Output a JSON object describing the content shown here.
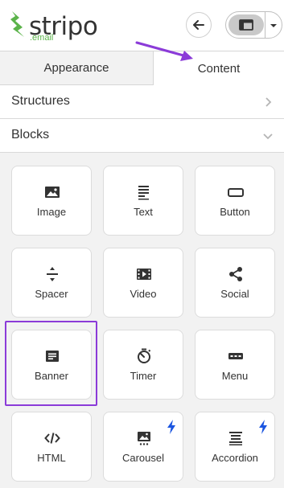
{
  "brand": {
    "name": "stripo",
    "sub": ".email",
    "accent": "#5bb34a"
  },
  "header": {
    "back_icon": "arrow-left-icon",
    "layout_icon": "layout-icon",
    "dropdown_icon": "chevron-down-icon"
  },
  "tabs": [
    {
      "label": "Appearance",
      "active": false
    },
    {
      "label": "Content",
      "active": true
    }
  ],
  "sections": {
    "structures": {
      "title": "Structures",
      "expanded": false
    },
    "blocks": {
      "title": "Blocks",
      "expanded": true
    }
  },
  "blocks": [
    {
      "label": "Image",
      "icon": "image-icon",
      "pro": false
    },
    {
      "label": "Text",
      "icon": "text-icon",
      "pro": false
    },
    {
      "label": "Button",
      "icon": "button-icon",
      "pro": false
    },
    {
      "label": "Spacer",
      "icon": "spacer-icon",
      "pro": false
    },
    {
      "label": "Video",
      "icon": "video-icon",
      "pro": false
    },
    {
      "label": "Social",
      "icon": "share-icon",
      "pro": false
    },
    {
      "label": "Banner",
      "icon": "banner-icon",
      "pro": false
    },
    {
      "label": "Timer",
      "icon": "timer-icon",
      "pro": false
    },
    {
      "label": "Menu",
      "icon": "menu-icon",
      "pro": false
    },
    {
      "label": "HTML",
      "icon": "code-icon",
      "pro": false
    },
    {
      "label": "Carousel",
      "icon": "carousel-icon",
      "pro": true
    },
    {
      "label": "Accordion",
      "icon": "accordion-icon",
      "pro": true
    }
  ],
  "colors": {
    "annotation": "#8b3bd8",
    "pro_bolt": "#1a55e0",
    "panel_bg": "#f2f2f2"
  }
}
